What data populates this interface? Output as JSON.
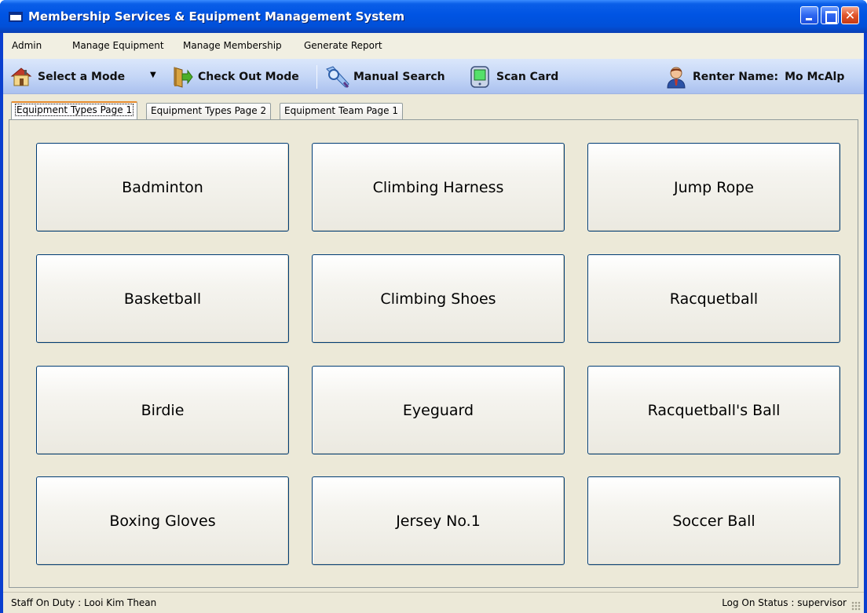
{
  "window": {
    "title": "Membership Services & Equipment Management System"
  },
  "menu": {
    "items": [
      {
        "label": "Admin"
      },
      {
        "label": "Manage Equipment"
      },
      {
        "label": "Manage Membership"
      },
      {
        "label": "Generate Report"
      }
    ]
  },
  "toolbar": {
    "select_mode_label": "Select a Mode",
    "select_mode_icon": "house-icon",
    "check_out_label": "Check Out Mode",
    "check_out_icon": "door-exit-icon",
    "manual_search_label": "Manual Search",
    "manual_search_icon": "magnifier-pen-icon",
    "scan_card_label": "Scan Card",
    "scan_card_icon": "card-reader-icon",
    "renter_label": "Renter Name:",
    "renter_name": "Mo McAlp",
    "renter_icon": "user-avatar-icon"
  },
  "tabs": [
    {
      "label": "Equipment Types Page 1",
      "active": true
    },
    {
      "label": "Equipment Types Page 2",
      "active": false
    },
    {
      "label": "Equipment Team Page 1",
      "active": false
    }
  ],
  "equipment": [
    "Badminton",
    "Climbing Harness",
    "Jump Rope",
    "Basketball",
    "Climbing Shoes",
    "Racquetball",
    "Birdie",
    "Eyeguard",
    "Racquetball's Ball",
    "Boxing Gloves",
    "Jersey No.1",
    "Soccer Ball"
  ],
  "status": {
    "staff_label": "Staff On Duty :",
    "staff_name": "Looi Kim Thean",
    "logon_label": "Log On Status :",
    "logon_value": "supervisor"
  },
  "colors": {
    "titlebar": "#0054e3",
    "toolbar": "#c3d5f6",
    "face": "#ece9d8",
    "button_border": "#003c74",
    "active_tab_accent": "#e68b2c"
  }
}
